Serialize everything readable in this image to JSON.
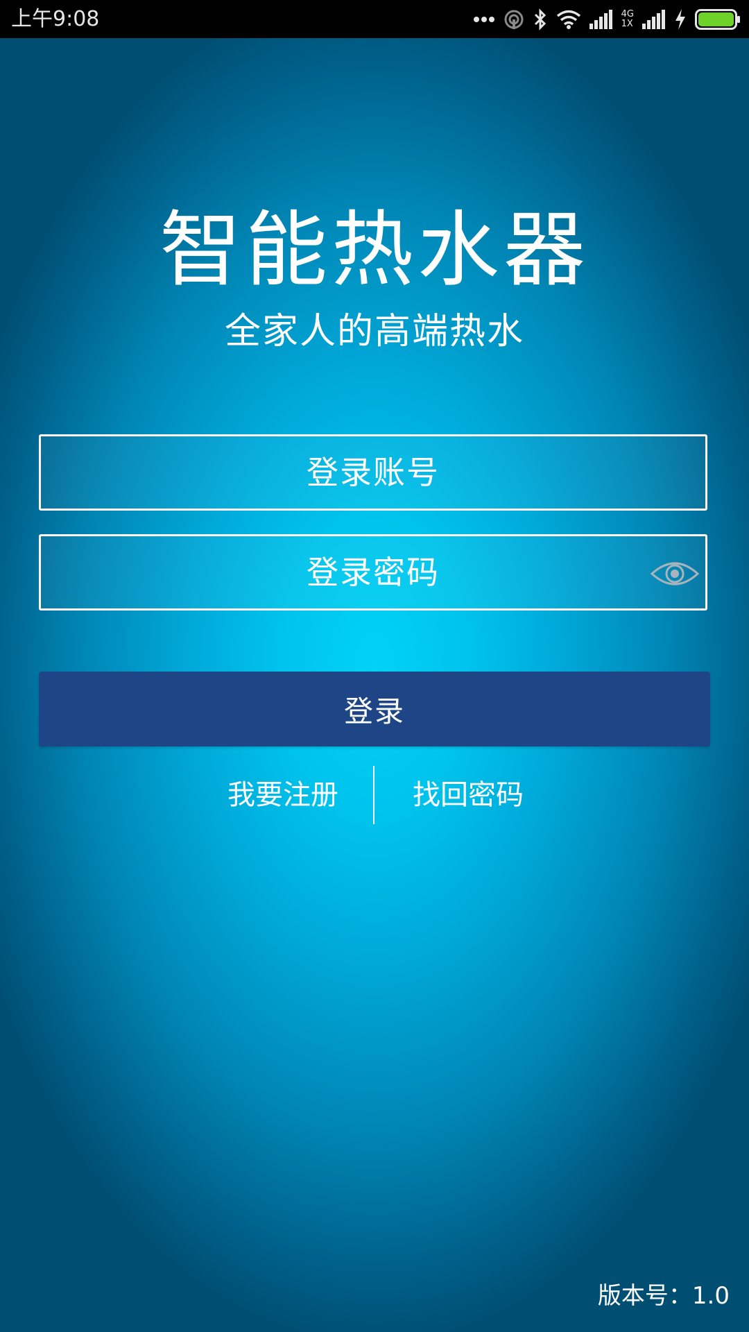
{
  "status_bar": {
    "time": "上午9:08",
    "network_label_top": "4G",
    "network_label_bottom": "1X",
    "icons": [
      "more-dots-icon",
      "hotspot-icon",
      "bluetooth-icon",
      "wifi-icon",
      "signal-icon",
      "signal-icon",
      "charging-icon",
      "battery-icon"
    ],
    "battery_level": 1.0,
    "battery_color": "#6fd22a"
  },
  "app": {
    "title": "智能热水器",
    "subtitle": "全家人的高端热水"
  },
  "form": {
    "account_placeholder": "登录账号",
    "password_placeholder": "登录密码",
    "login_label": "登录"
  },
  "links": {
    "register": "我要注册",
    "forgot_password": "找回密码"
  },
  "footer": {
    "version": "版本号：1.0"
  },
  "colors": {
    "background_center": "#02d2f6",
    "background_edge": "#004e72",
    "button": "#1e4585",
    "text": "#ffffff"
  }
}
